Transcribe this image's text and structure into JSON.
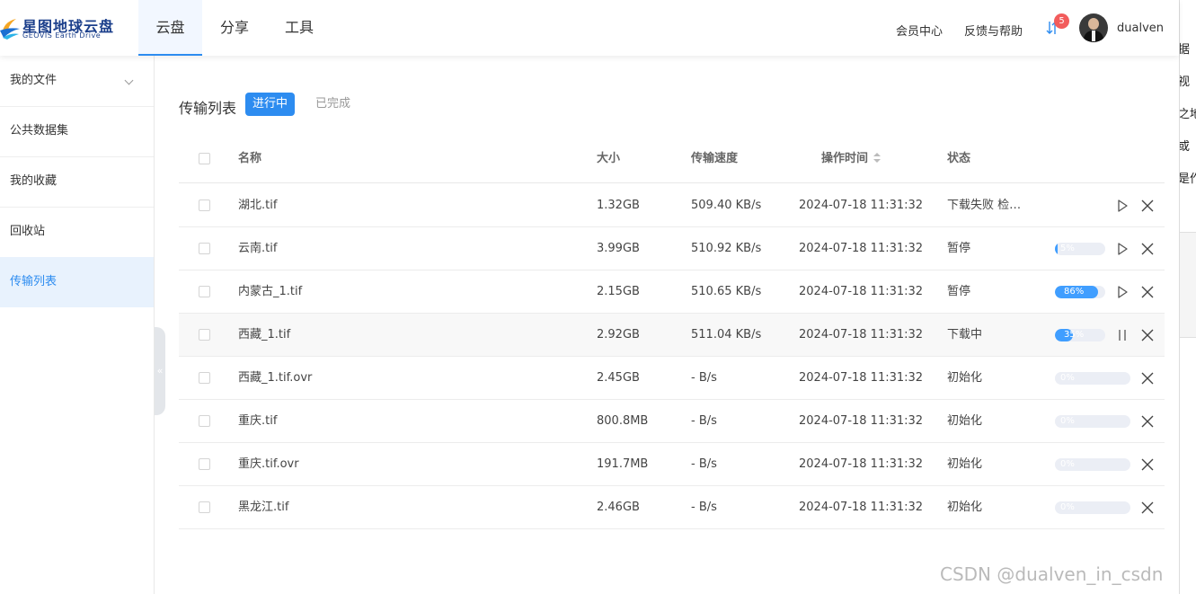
{
  "app": {
    "name": "星图地球云盘",
    "subtitle": "GEOVIS Earth Drive"
  },
  "nav": {
    "tabs": [
      "云盘",
      "分享",
      "工具"
    ],
    "active": "云盘"
  },
  "header": {
    "member_center": "会员中心",
    "feedback": "反馈与帮助",
    "notification_count": "5",
    "username": "dualven"
  },
  "sidebar": {
    "items": [
      {
        "label": "我的文件",
        "has_chevron": true
      },
      {
        "label": "公共数据集"
      },
      {
        "label": "我的收藏"
      },
      {
        "label": "回收站"
      },
      {
        "label": "传输列表",
        "active": true
      }
    ],
    "collapse_glyph": "«"
  },
  "transfer": {
    "title": "传输列表",
    "filter_in_progress": "进行中",
    "filter_done": "已完成",
    "columns": {
      "name": "名称",
      "size": "大小",
      "speed": "传输速度",
      "time": "操作时间",
      "status": "状态"
    },
    "rows": [
      {
        "name": "湖北.tif",
        "size": "1.32GB",
        "speed": "509.40 KB/s",
        "time": "2024-07-18 11:31:32",
        "status": "下载失败 检…",
        "progress": null,
        "progress_label": "",
        "actions": [
          "play",
          "close"
        ]
      },
      {
        "name": "云南.tif",
        "size": "3.99GB",
        "speed": "510.92 KB/s",
        "time": "2024-07-18 11:31:32",
        "status": "暂停",
        "progress": 5,
        "progress_label": "5%",
        "actions": [
          "play",
          "close"
        ]
      },
      {
        "name": "内蒙古_1.tif",
        "size": "2.15GB",
        "speed": "510.65 KB/s",
        "time": "2024-07-18 11:31:32",
        "status": "暂停",
        "progress": 86,
        "progress_label": "86%",
        "actions": [
          "play",
          "close"
        ]
      },
      {
        "name": "西藏_1.tif",
        "size": "2.92GB",
        "speed": "511.04 KB/s",
        "time": "2024-07-18 11:31:32",
        "status": "下载中",
        "progress": 35,
        "progress_label": "35%",
        "actions": [
          "pause",
          "close"
        ]
      },
      {
        "name": "西藏_1.tif.ovr",
        "size": "2.45GB",
        "speed": "- B/s",
        "time": "2024-07-18 11:31:32",
        "status": "初始化",
        "progress": 0,
        "progress_label": "0%",
        "actions": [
          "close"
        ]
      },
      {
        "name": "重庆.tif",
        "size": "800.8MB",
        "speed": "- B/s",
        "time": "2024-07-18 11:31:32",
        "status": "初始化",
        "progress": 0,
        "progress_label": "0%",
        "actions": [
          "close"
        ]
      },
      {
        "name": "重庆.tif.ovr",
        "size": "191.7MB",
        "speed": "- B/s",
        "time": "2024-07-18 11:31:32",
        "status": "初始化",
        "progress": 0,
        "progress_label": "0%",
        "actions": [
          "close"
        ]
      },
      {
        "name": "黑龙江.tif",
        "size": "2.46GB",
        "speed": "- B/s",
        "time": "2024-07-18 11:31:32",
        "status": "初始化",
        "progress": 0,
        "progress_label": "0%",
        "actions": [
          "close"
        ]
      }
    ]
  },
  "background_fragments": [
    "据",
    "视",
    "之地",
    "或",
    "是作"
  ],
  "watermark": "CSDN @dualven_in_csdn",
  "colors": {
    "accent": "#2d8cf0",
    "progress_fill": "#409eff",
    "badge": "#f25c5c",
    "brand": "#1b3f8b"
  }
}
